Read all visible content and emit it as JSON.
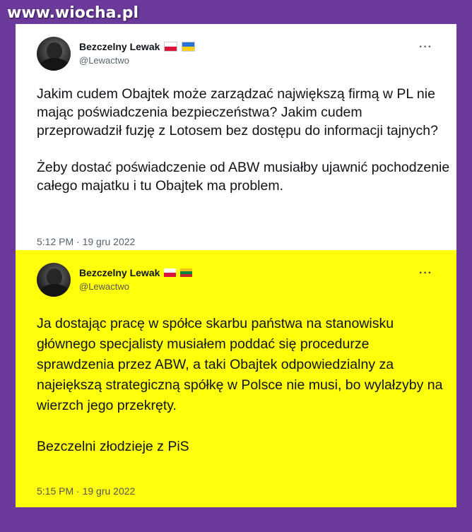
{
  "watermark": "www.wiocha.pl",
  "tweets": [
    {
      "author": "Bezczelny Lewak",
      "handle": "@Lewactwo",
      "more": "···",
      "text": "Jakim cudem Obajtek może zarządzać największą firmą w PL nie mając poświadczenia bezpieczeństwa? Jakim cudem przeprowadził fuzję z Lotosem bez dostępu do informacji tajnych?\n\nŻeby dostać poświadczenie od ABW musiałby ujawnić pochodzenie całego majatku i tu Obajtek ma problem.",
      "timestamp": "5:12 PM · 19 gru 2022",
      "background": "#ffffff"
    },
    {
      "author": "Bezczelny Lewak",
      "handle": "@Lewactwo",
      "more": "···",
      "text": "Ja dostając pracę w spółce skarbu państwa na stanowisku głównego specjalisty musiałem poddać się procedurze sprawdzenia przez ABW, a taki Obajtek odpowiedzialny za najeiększą strategiczną spółkę w Polsce nie musi, bo wylałzyby na wierzch jego przekręty.\n\nBezczelni złodzieje z PiS",
      "timestamp": "5:15 PM · 19 gru 2022",
      "background": "#ffff0b"
    }
  ],
  "colors": {
    "page_background": "#6b3a9a",
    "text": "#0f1419",
    "secondary_text": "#536471"
  }
}
